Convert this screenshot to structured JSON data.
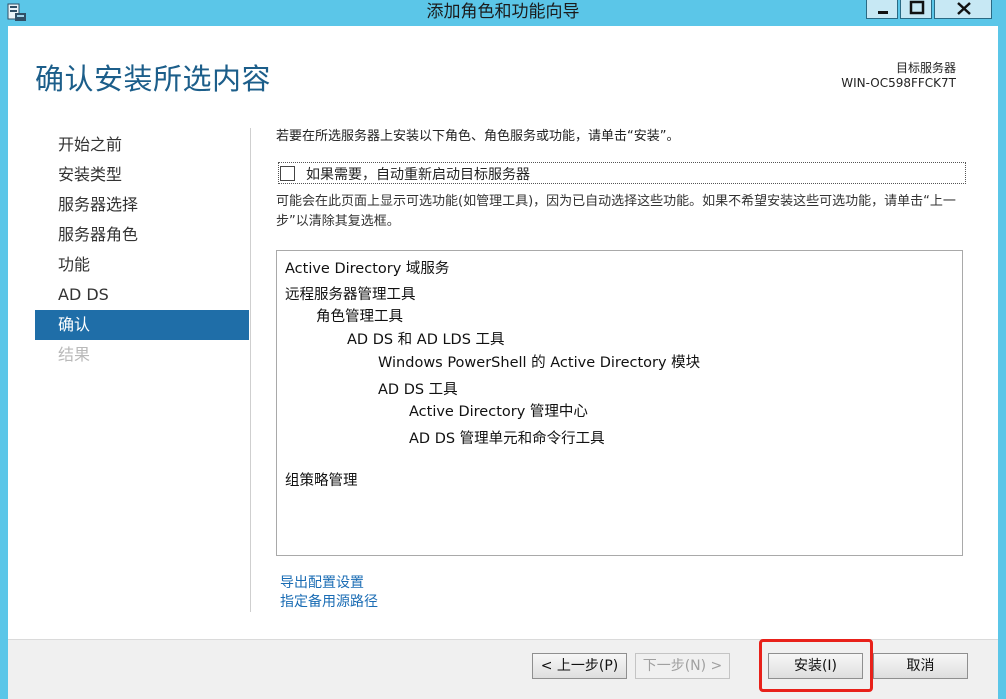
{
  "window": {
    "title": "添加角色和功能向导"
  },
  "header": {
    "page_title": "确认安装所选内容",
    "server_label": "目标服务器",
    "server_name": "WIN-OC598FFCK7T"
  },
  "nav": {
    "items": [
      {
        "label": "开始之前",
        "state": "normal"
      },
      {
        "label": "安装类型",
        "state": "normal"
      },
      {
        "label": "服务器选择",
        "state": "normal"
      },
      {
        "label": "服务器角色",
        "state": "normal"
      },
      {
        "label": "功能",
        "state": "normal"
      },
      {
        "label": "AD DS",
        "state": "normal"
      },
      {
        "label": "确认",
        "state": "active"
      },
      {
        "label": "结果",
        "state": "disabled"
      }
    ]
  },
  "content": {
    "intro": "若要在所选服务器上安装以下角色、角色服务或功能，请单击“安装”。",
    "restart_label": "如果需要，自动重新启动目标服务器",
    "restart_checked": false,
    "note": "可能会在此页面上显示可选功能(如管理工具)，因为已自动选择这些功能。如果不希望安装这些可选功能，请单击“上一步”以清除其复选框。",
    "summary": [
      "Active Directory 域服务",
      "远程服务器管理工具",
      "角色管理工具",
      "AD DS 和 AD LDS 工具",
      "Windows PowerShell 的 Active Directory 模块",
      "AD DS 工具",
      "Active Directory 管理中心",
      "AD DS 管理单元和命令行工具",
      "组策略管理"
    ],
    "links": {
      "export": "导出配置设置",
      "source": "指定备用源路径"
    }
  },
  "footer": {
    "prev_label": "< 上一步(P)",
    "next_label": "下一步(N) >",
    "install_label": "安装(I)",
    "cancel_label": "取消"
  },
  "colors": {
    "titlebar": "#5bc6e8",
    "accent": "#1f6ea8",
    "heading": "#1c5e8a",
    "link": "#1a6cb4",
    "highlight": "#e8211a"
  }
}
